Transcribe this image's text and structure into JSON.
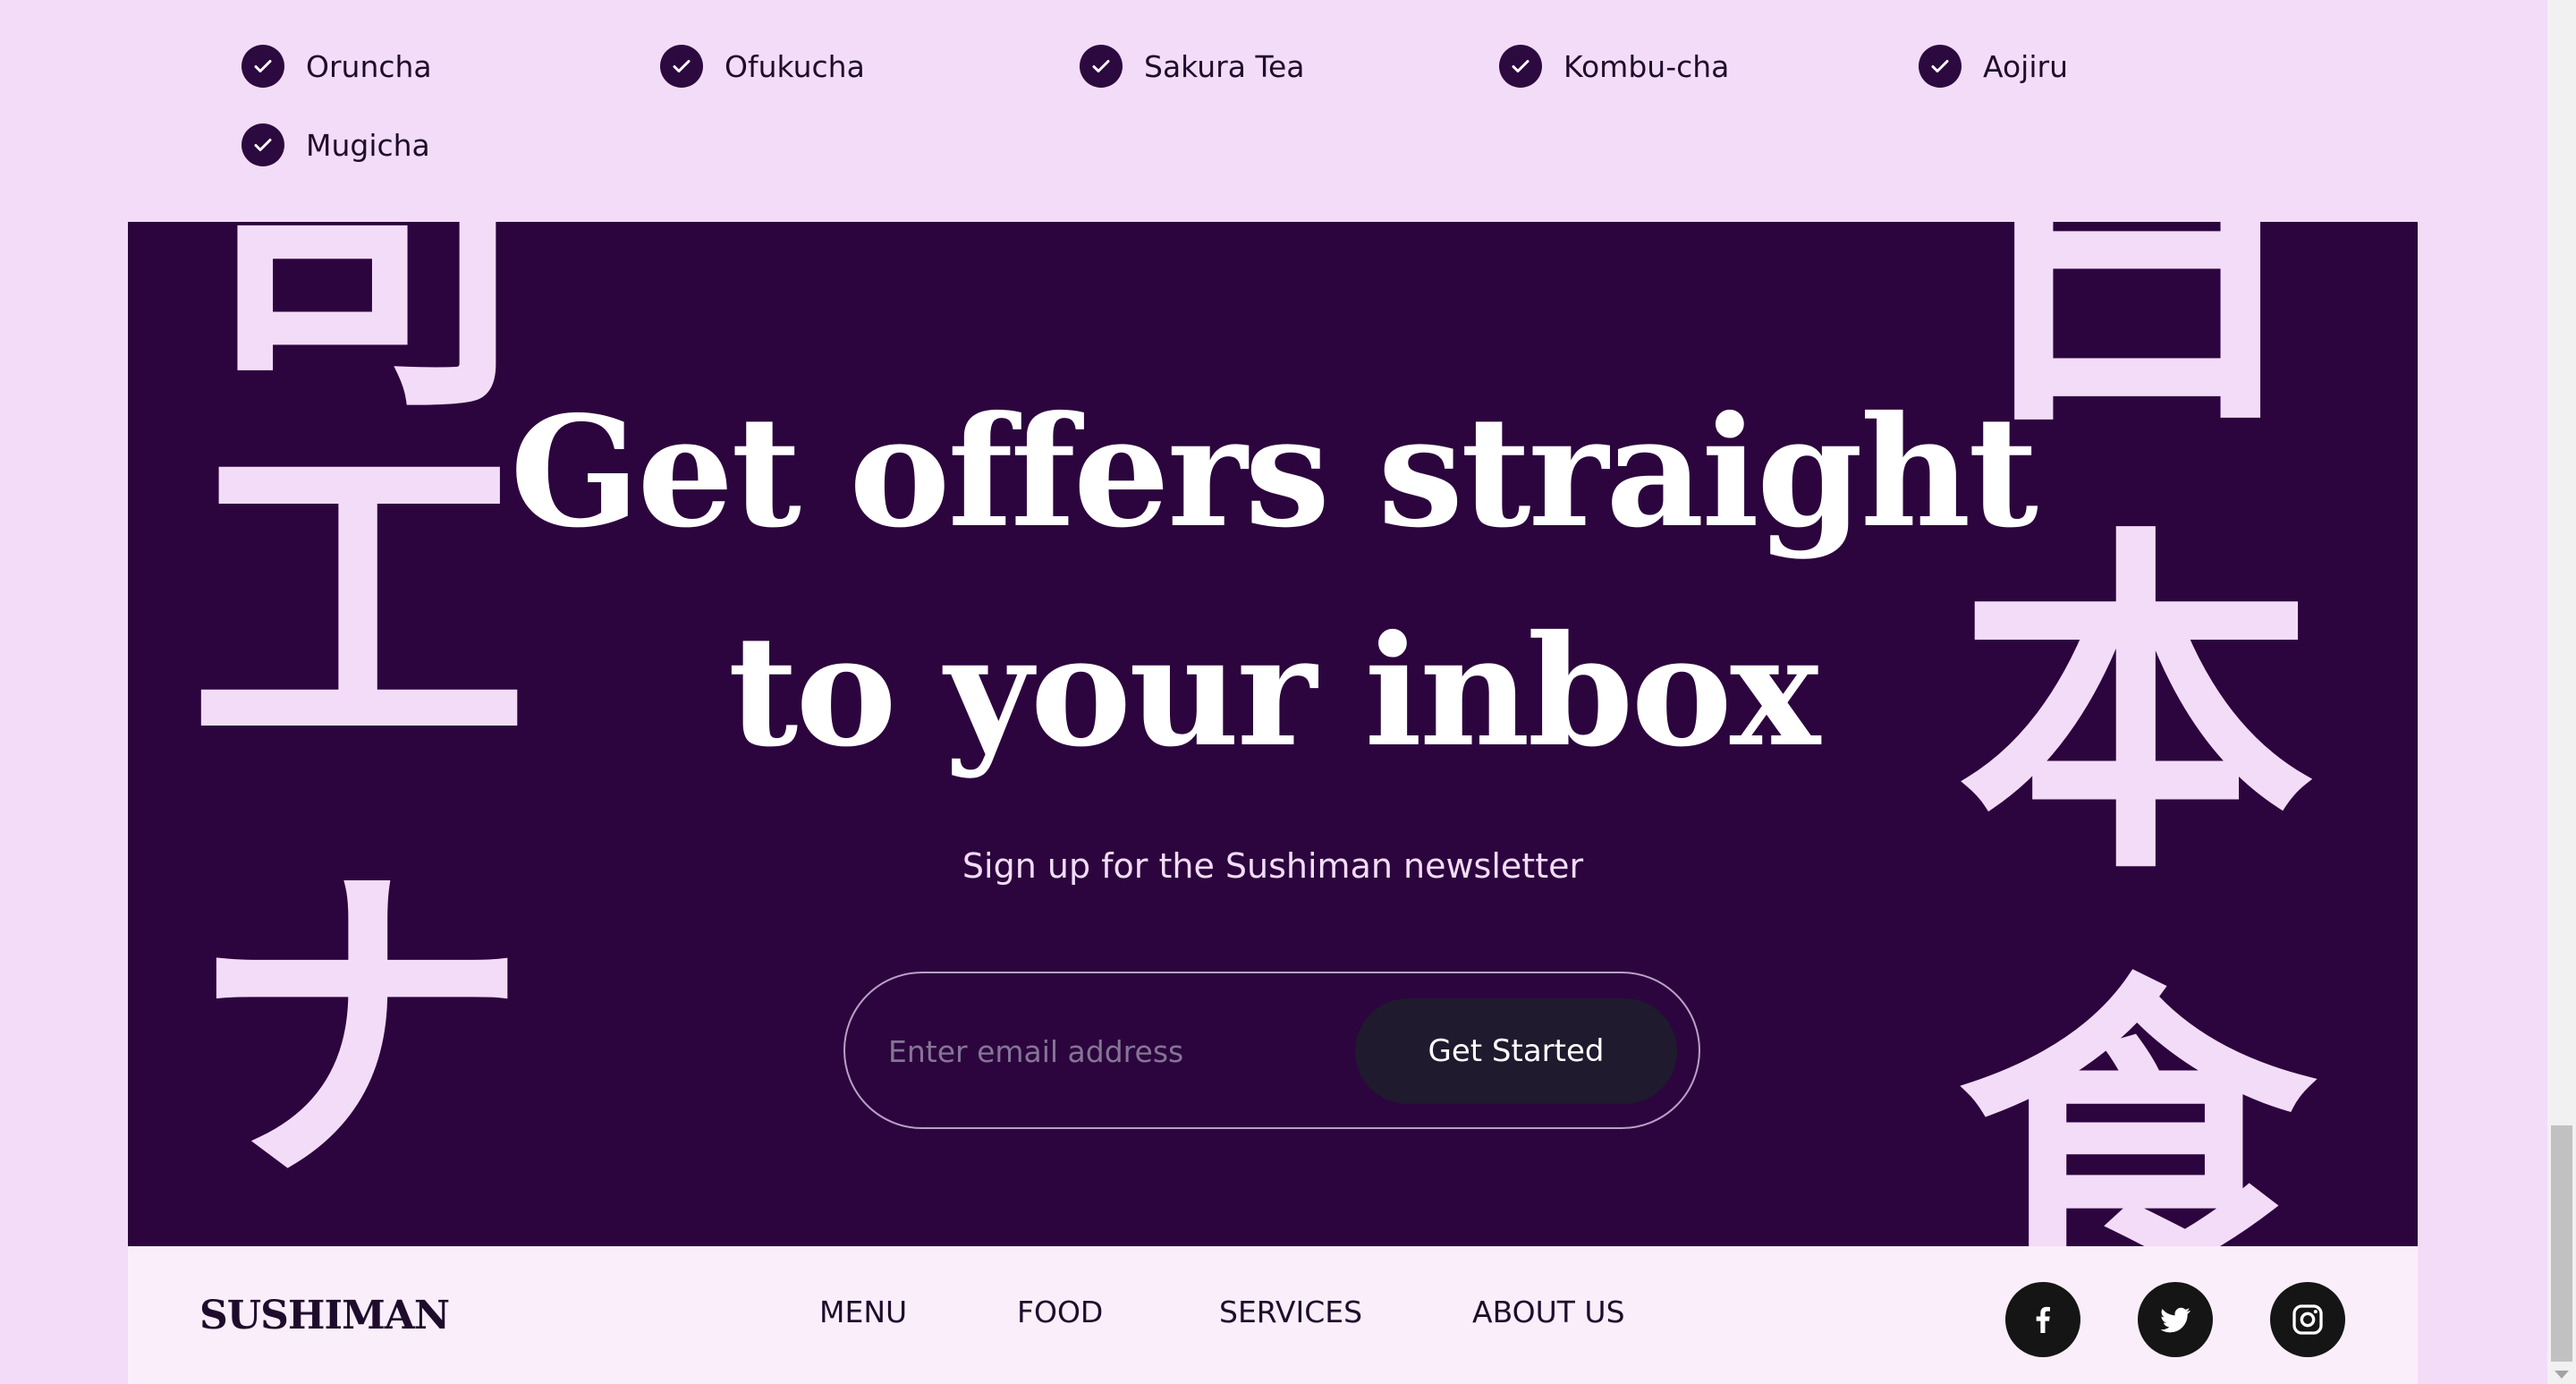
{
  "teas": [
    "Oruncha",
    "Ofukucha",
    "Sakura Tea",
    "Kombu-cha",
    "Aojiru",
    "Mugicha"
  ],
  "newsletter": {
    "headline_line1": "Get offers straight",
    "headline_line2": "to your inbox",
    "subhead": "Sign up for the Sushiman newsletter",
    "email_placeholder": "Enter email address",
    "button_label": "Get Started"
  },
  "decor": {
    "kanji_left": [
      "司",
      "工",
      "ナ"
    ],
    "kanji_right": [
      "日",
      "本",
      "食"
    ]
  },
  "footer": {
    "logo": "SUSHIMAN",
    "nav": [
      "MENU",
      "FOOD",
      "SERVICES",
      "ABOUT US"
    ],
    "social_icons": [
      "facebook-icon",
      "twitter-icon",
      "instagram-icon"
    ]
  },
  "colors": {
    "page_bg": "#f3dcf8",
    "band_bg": "#2c053e",
    "accent_dark": "#2c0a3f",
    "button_bg": "#1f1a2d",
    "footer_bg": "#fbeefb"
  }
}
